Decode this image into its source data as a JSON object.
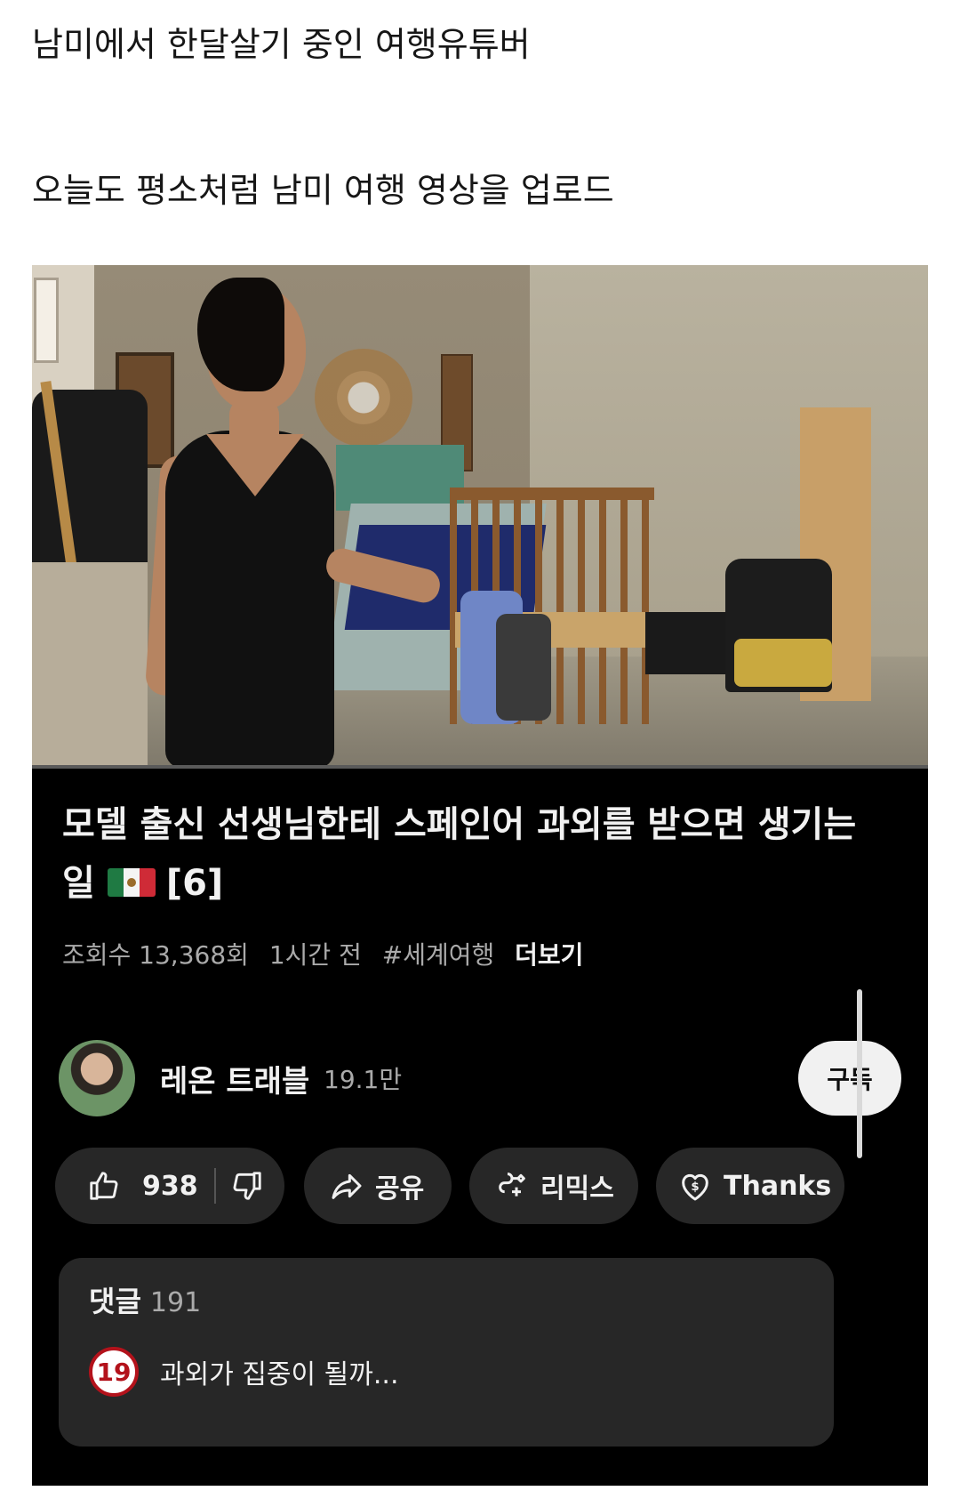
{
  "post": {
    "line1": "남미에서 한달살기 중인 여행유튜버",
    "line2": "오늘도 평소처럼 남미 여행 영상을 업로드"
  },
  "video": {
    "title_part1": "모델 출신 선생님한테 스페인어 과외를 받으면 생기는 일",
    "title_part2": "[6]",
    "flag_icon": "mexico-flag-icon",
    "views": "조회수 13,368회",
    "time": "1시간 전",
    "hashtag": "#세계여행",
    "more": "더보기"
  },
  "channel": {
    "name": "레온 트래블",
    "subscribers": "19.1만",
    "subscribe_label": "구독"
  },
  "actions": {
    "likes": "938",
    "share": "공유",
    "remix": "리믹스",
    "thanks": "Thanks"
  },
  "comments": {
    "label": "댓글",
    "count": "191",
    "badge": "19",
    "top_comment": "과외가 집중이 될까..."
  },
  "colors": {
    "card_bg": "#000000",
    "pill_bg": "#272727",
    "subscribe_bg": "#f1f1f1",
    "age_badge": "#b3121b"
  }
}
